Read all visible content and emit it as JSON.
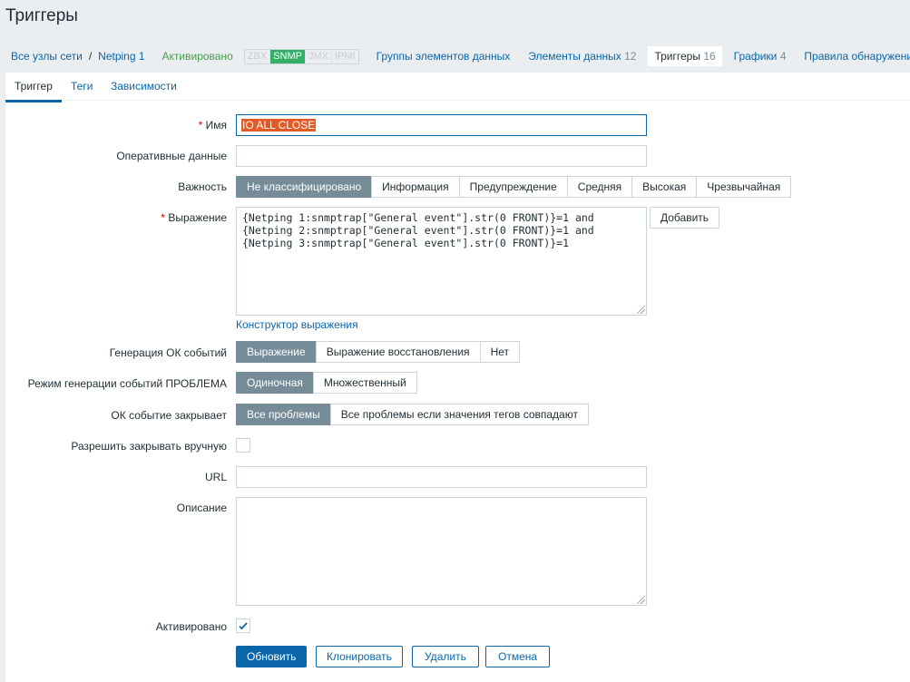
{
  "page_title": "Триггеры",
  "nav": {
    "all_hosts": "Все узлы сети",
    "separator": "/",
    "host": "Netping 1",
    "status": "Активировано",
    "availability": [
      {
        "label": "ZBX",
        "active": false
      },
      {
        "label": "SNMP",
        "active": true
      },
      {
        "label": "JMX",
        "active": false
      },
      {
        "label": "IPMI",
        "active": false
      }
    ],
    "tabs": [
      {
        "label": "Группы элементов данных",
        "count": ""
      },
      {
        "label": "Элементы данных",
        "count": "12"
      },
      {
        "label": "Триггеры",
        "count": "16"
      },
      {
        "label": "Графики",
        "count": "4"
      },
      {
        "label": "Правила обнаружения",
        "count": ""
      }
    ]
  },
  "subtabs": [
    "Триггер",
    "Теги",
    "Зависимости"
  ],
  "form": {
    "name_label": "Имя",
    "name_value": "IO ALL CLOSE",
    "opdata_label": "Оперативные данные",
    "opdata_value": "",
    "severity_label": "Важность",
    "severity": [
      "Не классифицировано",
      "Информация",
      "Предупреждение",
      "Средняя",
      "Высокая",
      "Чрезвычайная"
    ],
    "expression_label": "Выражение",
    "expression_value": "{Netping 1:snmptrap[\"General event\"].str(0 FRONT)}=1 and\n{Netping 2:snmptrap[\"General event\"].str(0 FRONT)}=1 and\n{Netping 3:snmptrap[\"General event\"].str(0 FRONT)}=1",
    "add_button": "Добавить",
    "constructor_link": "Конструктор выражения",
    "ok_gen_label": "Генерация ОК событий",
    "ok_gen": [
      "Выражение",
      "Выражение восстановления",
      "Нет"
    ],
    "problem_mode_label": "Режим генерации событий ПРОБЛЕМА",
    "problem_mode": [
      "Одиночная",
      "Множественный"
    ],
    "ok_closes_label": "ОК событие закрывает",
    "ok_closes": [
      "Все проблемы",
      "Все проблемы если значения тегов совпадают"
    ],
    "manual_close_label": "Разрешить закрывать вручную",
    "manual_close": false,
    "url_label": "URL",
    "url_value": "",
    "description_label": "Описание",
    "description_value": "",
    "enabled_label": "Активировано",
    "enabled": true,
    "buttons": {
      "update": "Обновить",
      "clone": "Клонировать",
      "delete": "Удалить",
      "cancel": "Отмена"
    }
  }
}
